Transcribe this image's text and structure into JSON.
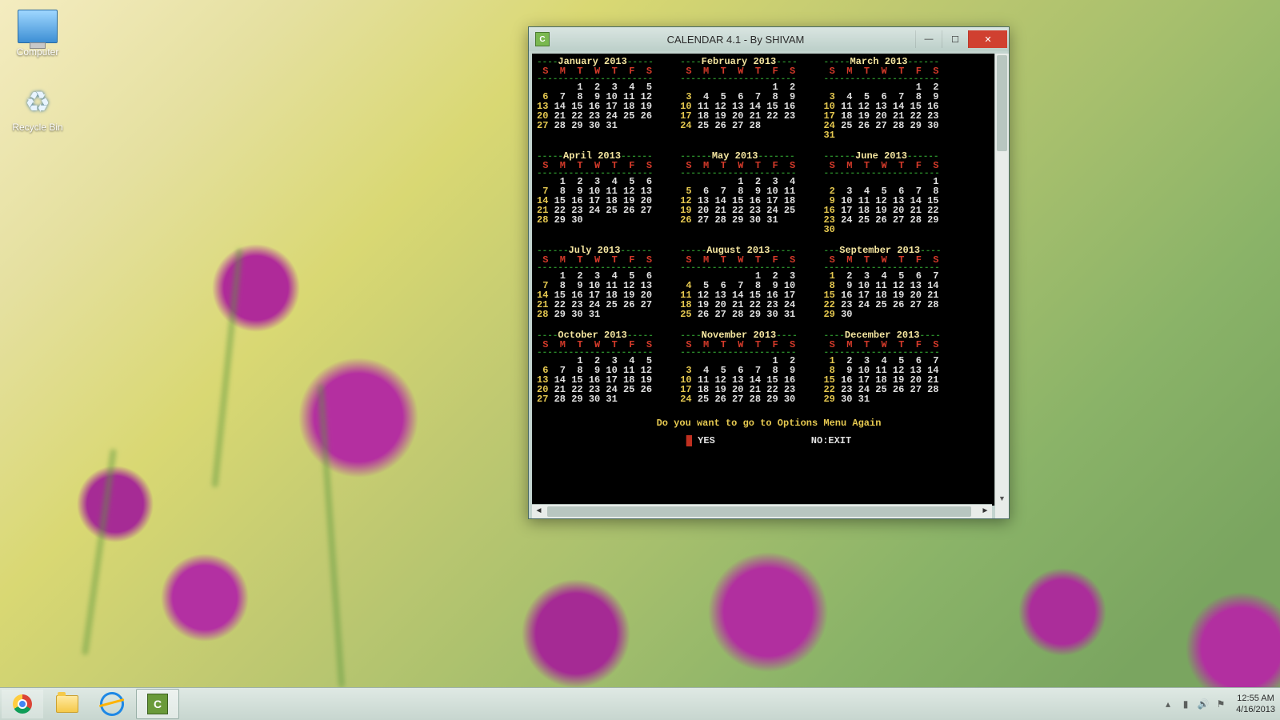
{
  "desktop_icons": {
    "computer": "Computer",
    "recycle": "Recycle Bin"
  },
  "window": {
    "title": "CALENDAR 4.1 - By SHIVAM"
  },
  "calendar": {
    "year": 2013,
    "dow_header": " S  M  T  W  T  F  S",
    "rule": "----------------------",
    "months": [
      {
        "name": "January 2013",
        "start": 2,
        "days": 31
      },
      {
        "name": "February 2013",
        "start": 5,
        "days": 28
      },
      {
        "name": "March 2013",
        "start": 5,
        "days": 31
      },
      {
        "name": "April 2013",
        "start": 1,
        "days": 30
      },
      {
        "name": "May 2013",
        "start": 3,
        "days": 31
      },
      {
        "name": "June 2013",
        "start": 6,
        "days": 30
      },
      {
        "name": "July 2013",
        "start": 1,
        "days": 31
      },
      {
        "name": "August 2013",
        "start": 4,
        "days": 31
      },
      {
        "name": "September 2013",
        "start": 0,
        "days": 30
      },
      {
        "name": "October 2013",
        "start": 2,
        "days": 31
      },
      {
        "name": "November 2013",
        "start": 5,
        "days": 30
      },
      {
        "name": "December 2013",
        "start": 0,
        "days": 31
      }
    ],
    "prompt": "Do you want to go to Options Menu Again",
    "yes": "YES",
    "no": "NO:EXIT"
  },
  "taskbar": {
    "items": [
      "chrome",
      "explorer",
      "internet-explorer",
      "calendar-app"
    ],
    "time": "12:55 AM",
    "date": "4/16/2013"
  }
}
